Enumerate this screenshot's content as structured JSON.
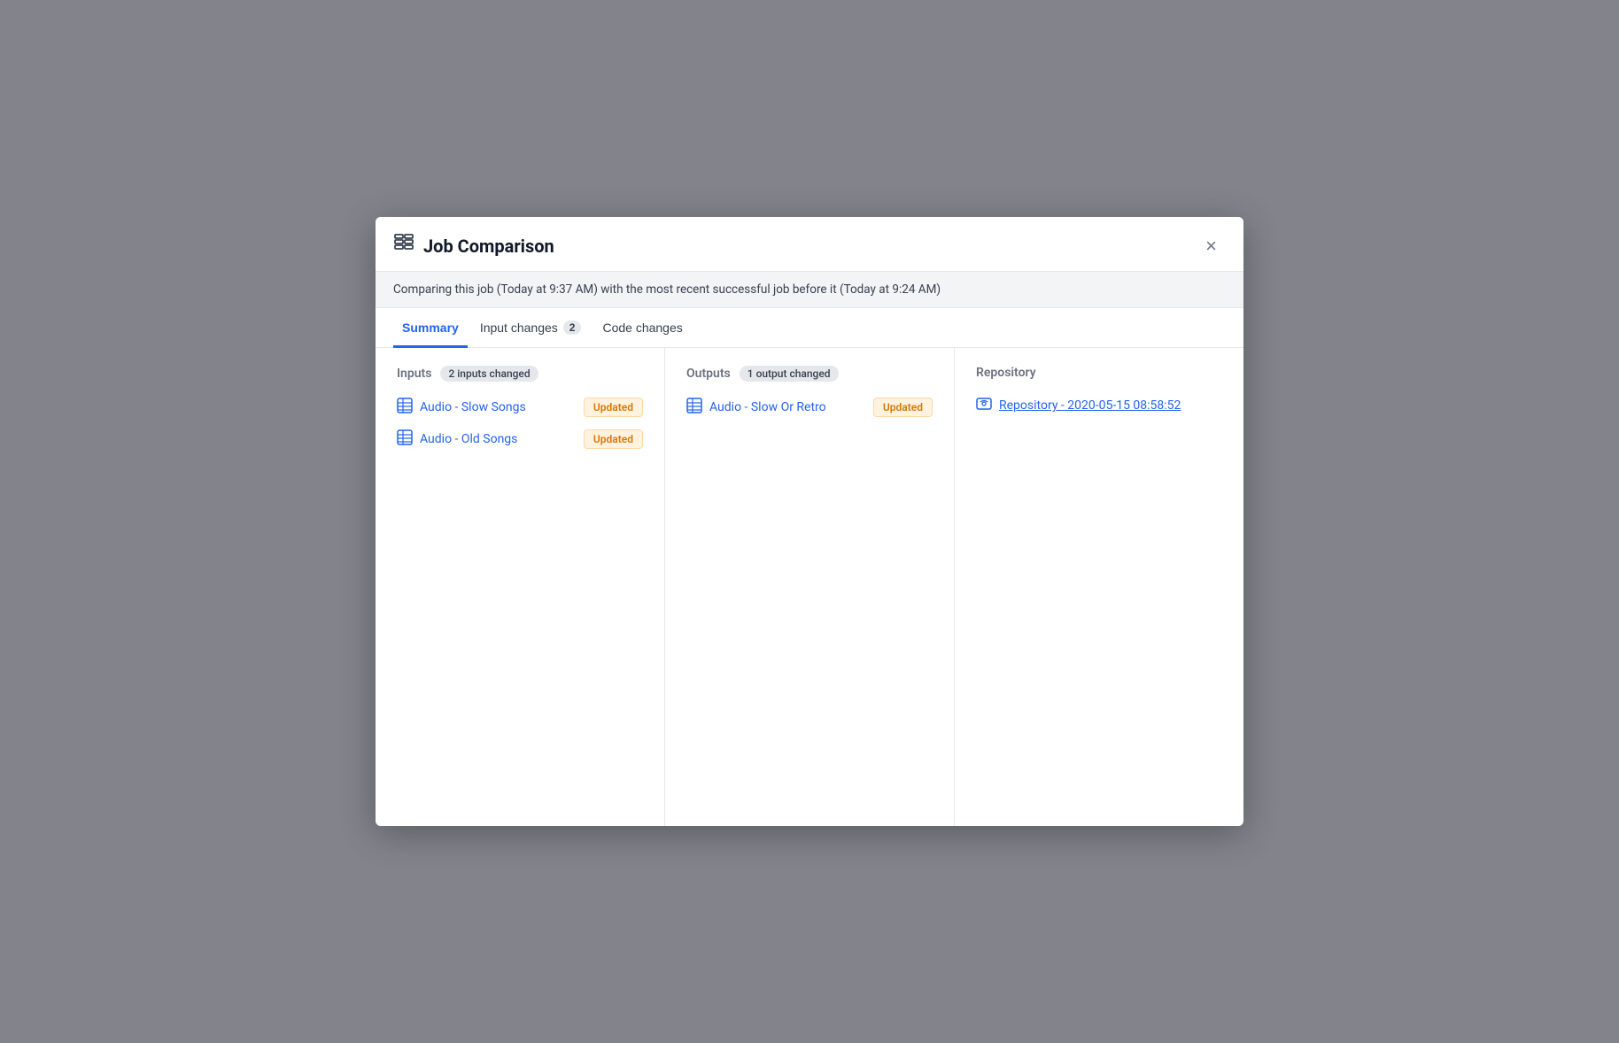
{
  "modal": {
    "title": "Job Comparison",
    "subtitle": "Comparing this job (Today at 9:37 AM) with the most recent successful job before it (Today at 9:24 AM)",
    "close_label": "×",
    "tabs": [
      {
        "id": "summary",
        "label": "Summary",
        "badge": null,
        "active": true
      },
      {
        "id": "input-changes",
        "label": "Input changes",
        "badge": "2",
        "active": false
      },
      {
        "id": "code-changes",
        "label": "Code changes",
        "badge": null,
        "active": false
      }
    ],
    "sections": {
      "inputs": {
        "label": "Inputs",
        "badge": "2 inputs changed",
        "items": [
          {
            "name": "Audio - Slow Songs",
            "status": "Updated"
          },
          {
            "name": "Audio - Old Songs",
            "status": "Updated"
          }
        ]
      },
      "outputs": {
        "label": "Outputs",
        "badge": "1 output changed",
        "items": [
          {
            "name": "Audio - Slow Or Retro",
            "status": "Updated"
          }
        ]
      },
      "repository": {
        "label": "Repository",
        "items": [
          {
            "name": "Repository - 2020-05-15 08:58:52"
          }
        ]
      }
    }
  }
}
